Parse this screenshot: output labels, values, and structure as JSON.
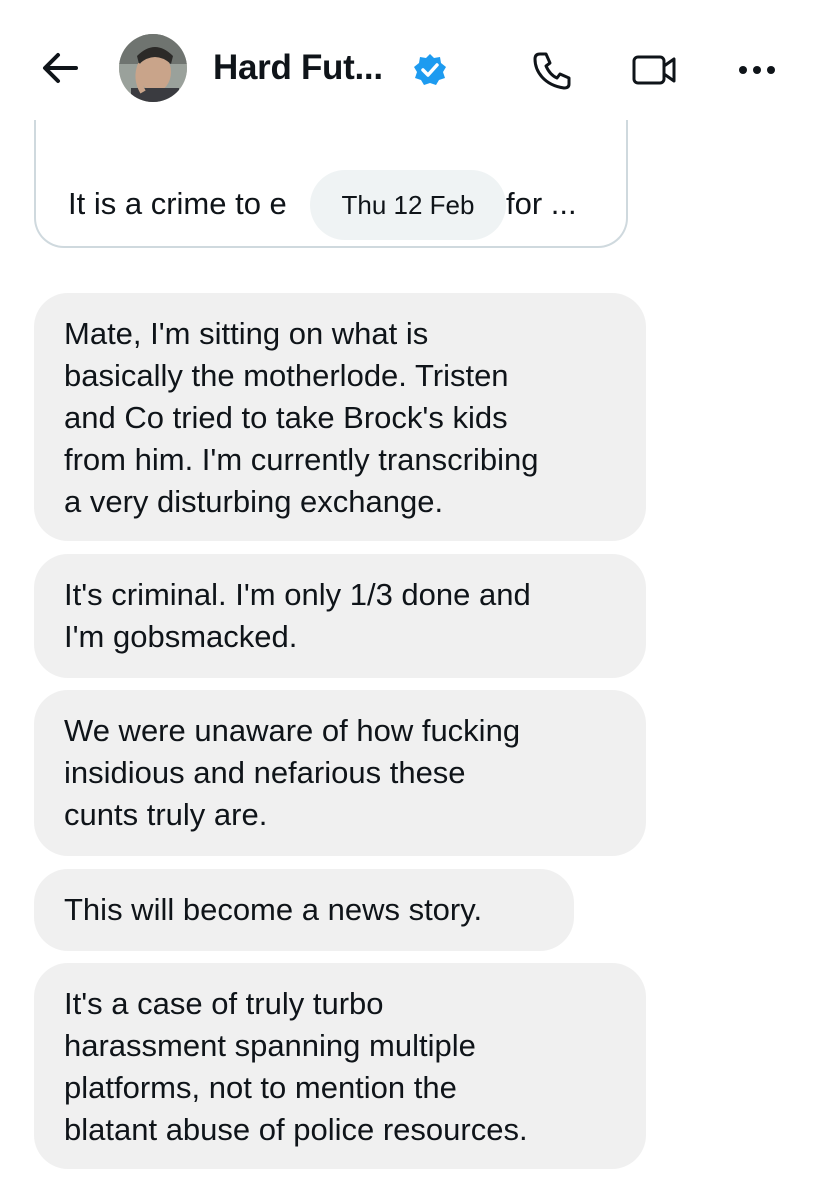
{
  "header": {
    "contact_name": "Hard Fut...",
    "icons": {
      "back": "back-arrow-icon",
      "verified": "verified-badge-icon",
      "call": "phone-icon",
      "video": "video-camera-icon",
      "more": "more-horizontal-icon"
    },
    "verified_color": "#1d9bf0"
  },
  "quoted_message": {
    "text_start": "It is a crime to e",
    "text_end": "for ..."
  },
  "date_separator": "Thu 12 Feb",
  "messages": [
    {
      "text": "Mate, I'm sitting on what is\nbasically the motherlode. Tristen\nand Co tried to take Brock's kids\nfrom him. I'm currently transcribing\na very disturbing exchange."
    },
    {
      "text": "It's criminal. I'm only 1/3 done and\nI'm gobsmacked."
    },
    {
      "text": "We were unaware of how fucking\ninsidious and nefarious these\ncunts truly are."
    },
    {
      "text": "This will become a news story."
    },
    {
      "text": "It's a case of truly turbo\nharassment spanning multiple\nplatforms, not to mention the\nblatant abuse of police resources."
    }
  ]
}
